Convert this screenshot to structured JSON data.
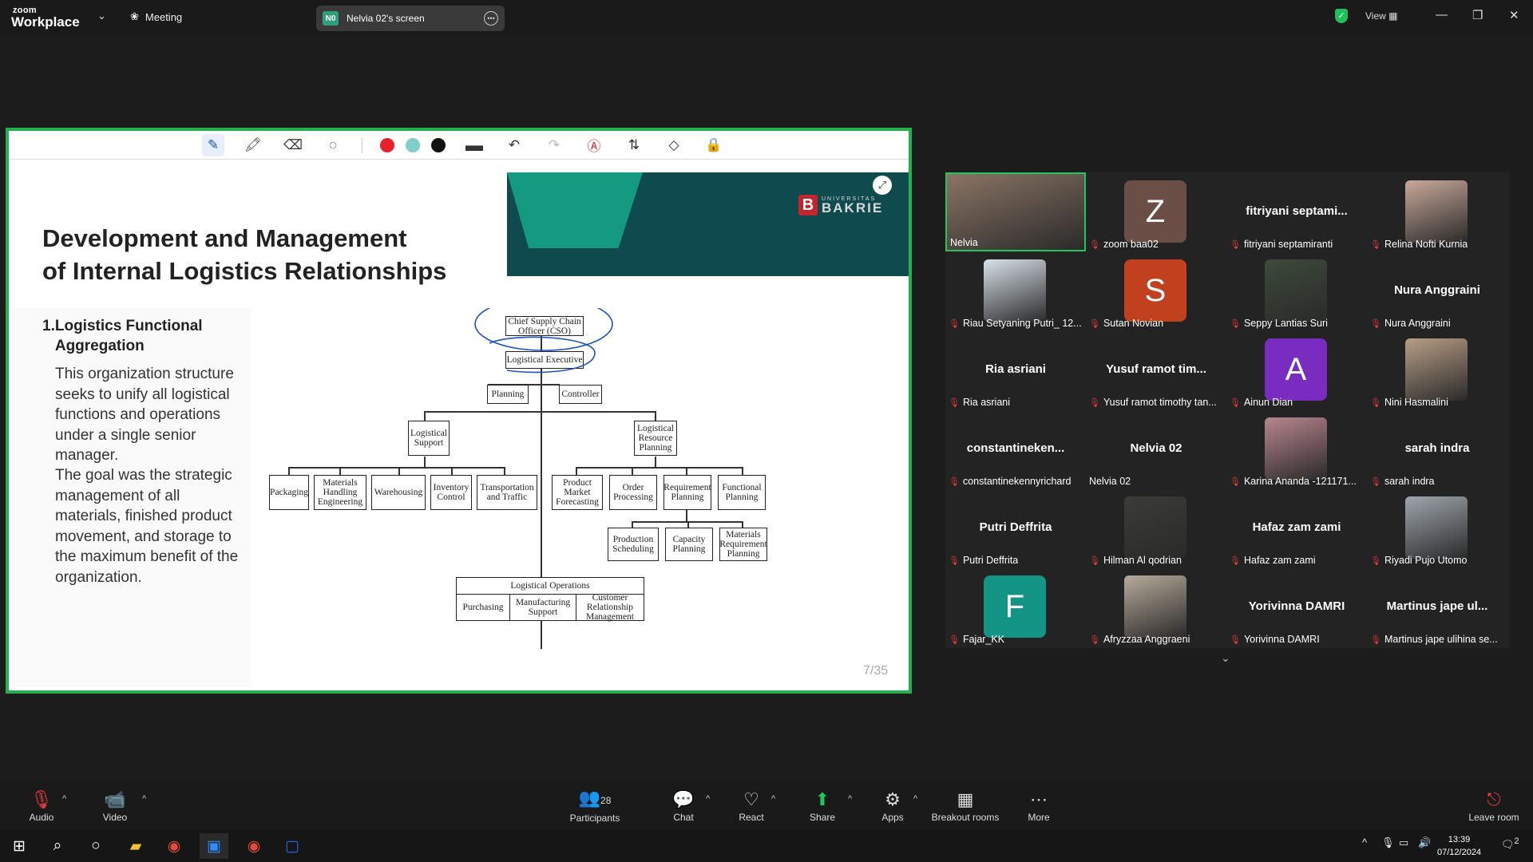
{
  "app": {
    "logo_top": "zoom",
    "logo_bottom": "Workplace",
    "meeting_label": "Meeting"
  },
  "screen_pill": {
    "badge": "N0",
    "label": "Nelvia 02's screen"
  },
  "topright": {
    "view_label": "View"
  },
  "annotation_toolbar": {
    "colors": [
      "#e8202a",
      "#7fcfc8",
      "#111111"
    ]
  },
  "slide": {
    "title_line1": "Development and Management",
    "title_line2": "of Internal Logistics Relationships",
    "sub_num": "1.",
    "sub_text": "Logistics Functional Aggregation",
    "para1": "This organization structure seeks to unify all logistical functions and operations under a single senior manager.",
    "para2": "The goal was the strategic management of all materials, finished product movement, and storage to the maximum benefit of the organization.",
    "brand_small": "UNIVERSITAS",
    "brand_big": "BAKRIE",
    "brand_letter": "B",
    "page": "7/35"
  },
  "org_chart": {
    "cso": "Chief Supply Chain Officer (CSO)",
    "exec": "Logistical Executive",
    "planning": "Planning",
    "controller": "Controller",
    "support": "Logistical Support",
    "resource": "Logistical Resource Planning",
    "packaging": "Packaging",
    "materials": "Materials Handling Engineering",
    "warehousing": "Warehousing",
    "inventory": "Inventory Control",
    "transport": "Transportation and Traffic",
    "forecasting": "Product Market Forecasting",
    "order": "Order Processing",
    "requirement": "Requirement Planning",
    "functional": "Functional Planning",
    "production": "Production Scheduling",
    "capacity": "Capacity Planning",
    "mrp": "Materials Requirement Planning",
    "operations": "Logistical Operations",
    "purchasing": "Purchasing",
    "manufacturing": "Manufacturing Support",
    "crm": "Customer Relationship Management"
  },
  "participants": [
    {
      "name": "Nelvia",
      "type": "photo",
      "muted": false,
      "active": true,
      "color": "#8a7464"
    },
    {
      "name": "zoom baa02",
      "type": "letter",
      "letter": "Z",
      "color": "#6b4f47",
      "muted": true
    },
    {
      "name": "fitriyani septamiranti",
      "type": "text",
      "big": "fitriyani septami...",
      "muted": true
    },
    {
      "name": "Relina Nofti Kurnia",
      "type": "photo",
      "color": "#c9a99a",
      "muted": true
    },
    {
      "name": "Riau Setyaning Putri_ 12...",
      "type": "photo",
      "color": "#d9e2ea",
      "muted": true
    },
    {
      "name": "Sutan Novian",
      "type": "letter",
      "letter": "S",
      "color": "#c1401e",
      "muted": true
    },
    {
      "name": "Seppy Lantias Suri",
      "type": "photo",
      "color": "#3d4a3a",
      "muted": true
    },
    {
      "name": "Nura Anggraini",
      "type": "text",
      "big": "Nura Anggraini",
      "muted": true
    },
    {
      "name": "Ria asriani",
      "type": "text",
      "big": "Ria asriani",
      "muted": true
    },
    {
      "name": "Yusuf ramot timothy tan...",
      "type": "text",
      "big": "Yusuf ramot tim...",
      "muted": true
    },
    {
      "name": "Ainun Dian",
      "type": "letter",
      "letter": "A",
      "color": "#7a2bc0",
      "muted": true
    },
    {
      "name": "Nini Hasmalini",
      "type": "photo",
      "color": "#b89e86",
      "muted": true
    },
    {
      "name": "constantinekennyrichard",
      "type": "text",
      "big": "constantineken...",
      "muted": true
    },
    {
      "name": "Nelvia 02",
      "type": "text",
      "big": "Nelvia 02",
      "muted": false
    },
    {
      "name": "Karina Ananda -121171...",
      "type": "photo",
      "color": "#b8868f",
      "muted": true
    },
    {
      "name": "sarah indra",
      "type": "text",
      "big": "sarah indra",
      "muted": true
    },
    {
      "name": "Putri Deffrita",
      "type": "text",
      "big": "Putri Deffrita",
      "muted": true
    },
    {
      "name": "Hilman Al qodrian",
      "type": "photo",
      "color": "#3b3b36",
      "muted": true
    },
    {
      "name": "Hafaz zam zami",
      "type": "text",
      "big": "Hafaz zam zami",
      "muted": true
    },
    {
      "name": "Riyadi Pujo Utomo",
      "type": "photo",
      "color": "#9fa6ad",
      "muted": true
    },
    {
      "name": "Fajar_KK",
      "type": "letter",
      "letter": "F",
      "color": "#139484",
      "muted": true
    },
    {
      "name": "Afryzzaa Anggraeni",
      "type": "photo",
      "color": "#b7aa9a",
      "muted": true
    },
    {
      "name": "Yorivinna DAMRI",
      "type": "text",
      "big": "Yorivinna DAMRI",
      "muted": true
    },
    {
      "name": "Martinus jape ulihina se...",
      "type": "text",
      "big": "Martinus jape ul...",
      "muted": true
    }
  ],
  "bottom": {
    "audio": "Audio",
    "video": "Video",
    "participants": "Participants",
    "participants_count": "28",
    "chat": "Chat",
    "react": "React",
    "share": "Share",
    "apps": "Apps",
    "breakout": "Breakout rooms",
    "more": "More",
    "leave": "Leave room"
  },
  "taskbar": {
    "time": "13:39",
    "date": "07/12/2024",
    "notifications": "2"
  }
}
